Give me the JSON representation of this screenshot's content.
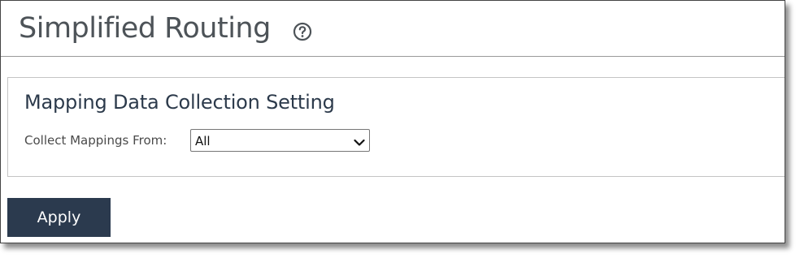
{
  "header": {
    "title": "Simplified Routing",
    "help_icon": "question-circle-icon"
  },
  "panel": {
    "section_title": "Mapping Data Collection Setting",
    "collect_label": "Collect Mappings From:",
    "collect_select": {
      "selected": "All",
      "icon": "chevron-down-icon"
    }
  },
  "actions": {
    "apply_label": "Apply"
  },
  "colors": {
    "button_bg": "#2b3a4e",
    "title_text": "#4d5358",
    "section_text": "#2c3a4b"
  }
}
